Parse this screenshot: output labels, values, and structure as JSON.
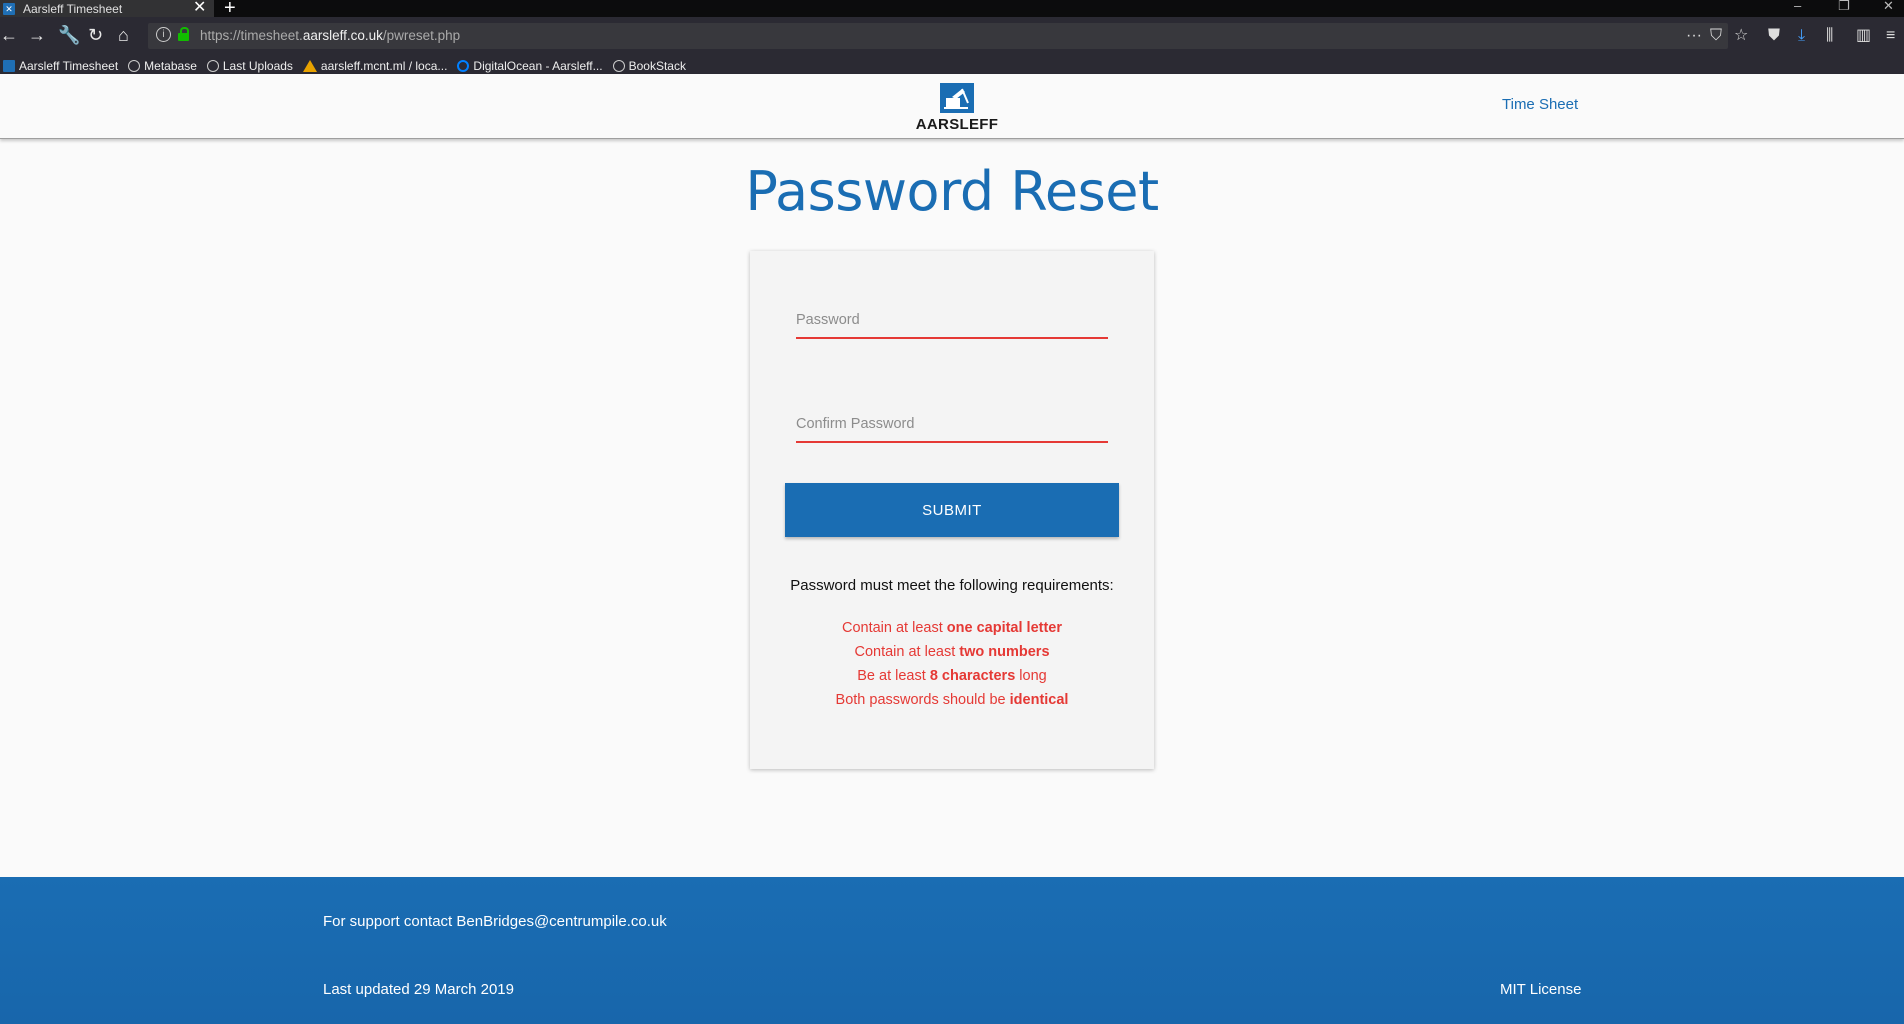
{
  "browser": {
    "tab_title": "Aarsleff Timesheet",
    "tab_close": "✕",
    "new_tab": "+",
    "url_prefix": "https://timesheet.",
    "url_host": "aarsleff.co.uk",
    "url_path": "/pwreset.php",
    "bookmarks": [
      {
        "label": "Aarsleff Timesheet",
        "icon": "aarsleff-logo-icon"
      },
      {
        "label": "Metabase",
        "icon": "globe-icon"
      },
      {
        "label": "Last Uploads",
        "icon": "globe-icon"
      },
      {
        "label": "aarsleff.mcnt.ml / loca...",
        "icon": "phpmyadmin-icon"
      },
      {
        "label": "DigitalOcean - Aarsleff...",
        "icon": "digitalocean-icon"
      },
      {
        "label": "BookStack",
        "icon": "globe-icon"
      }
    ]
  },
  "header": {
    "logo_text": "AARSLEFF",
    "nav_link": "Time Sheet"
  },
  "main": {
    "title": "Password Reset",
    "password_placeholder": "Password",
    "confirm_placeholder": "Confirm Password",
    "submit_label": "SUBMIT",
    "requirements_title": "Password must meet the following requirements:",
    "requirements": [
      {
        "pre": "Contain at least ",
        "bold": "one capital letter",
        "post": ""
      },
      {
        "pre": "Contain at least ",
        "bold": "two numbers",
        "post": ""
      },
      {
        "pre": "Be at least ",
        "bold": "8 characters",
        "post": " long"
      },
      {
        "pre": "Both passwords should be ",
        "bold": "identical",
        "post": ""
      }
    ]
  },
  "footer": {
    "support": "For support contact BenBridges@centrumpile.co.uk",
    "updated": "Last updated 29 March 2019",
    "license": "MIT License"
  },
  "colors": {
    "brand_blue": "#1a6db3",
    "error_red": "#e53935",
    "page_bg": "#fafafa"
  }
}
